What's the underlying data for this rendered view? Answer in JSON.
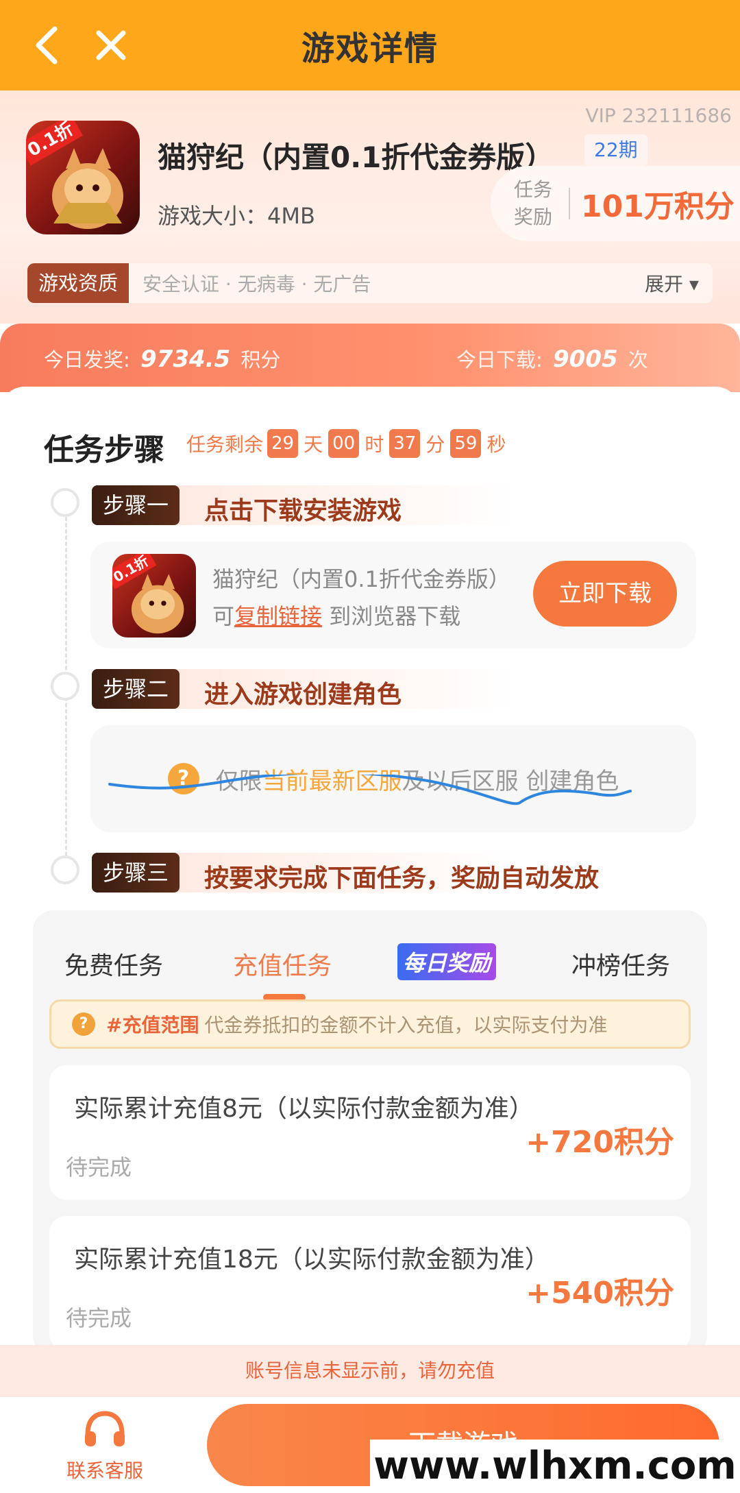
{
  "header": {
    "title": "游戏详情"
  },
  "game": {
    "vip": "VIP 232111686",
    "name": "猫狩纪（内置0.1折代金券版）",
    "period": "22期",
    "size": "游戏大小：4MB",
    "icon_badge": "0.1折",
    "reward_label": "任务奖励",
    "reward_amount": "101万积分",
    "qual_tag": "游戏资质",
    "qual_items": "安全认证 · 无病毒 · 无广告",
    "expand": "展开 ▾"
  },
  "stats": {
    "award_label": "今日发奖:",
    "award_value": "9734.5",
    "award_unit": "积分",
    "download_label": "今日下载:",
    "download_value": "9005",
    "download_unit": "次"
  },
  "steps": {
    "title": "任务步骤",
    "countdown_prefix": "任务剩余",
    "days": "29",
    "days_u": "天",
    "hours": "00",
    "hours_u": "时",
    "minutes": "37",
    "minutes_u": "分",
    "seconds": "59",
    "seconds_u": "秒",
    "step1_tag": "步骤一",
    "step1_text": "点击下载安装游戏",
    "step1_game": "猫狩纪（内置0.1折代金券版）",
    "step1_copy_prefix": "可",
    "step1_copy_link": "复制链接",
    "step1_copy_suffix": " 到浏览器下载",
    "step1_button": "立即下载",
    "step2_tag": "步骤二",
    "step2_text": "进入游戏创建角色",
    "step2_note_prefix": "仅限",
    "step2_note_hl": "当前最新区服",
    "step2_note_suffix": "及以后区服 创建角色",
    "step3_tag": "步骤三",
    "step3_text": "按要求完成下面任务，奖励自动发放"
  },
  "tabs": [
    "免费任务",
    "充值任务",
    "每日奖励",
    "冲榜任务"
  ],
  "notice": {
    "hl": "#充值范围",
    "text": "代金券抵扣的金额不计入充值，以实际支付为准"
  },
  "tasks": [
    {
      "desc": "实际累计充值8元（以实际付款金额为准）",
      "points": "+720积分",
      "status": "待完成"
    },
    {
      "desc": "实际累计充值18元（以实际付款金额为准）",
      "points": "+540积分",
      "status": "待完成"
    }
  ],
  "footer": {
    "warning": "账号信息未显示前，请勿充值",
    "cs_label": "联系客服",
    "main_button": "下载游戏",
    "watermark": "www.wlhxm.com"
  },
  "colors": {
    "header": "#FFA71A",
    "accent": "#F5793F",
    "step_tag": "#3A1E12"
  }
}
